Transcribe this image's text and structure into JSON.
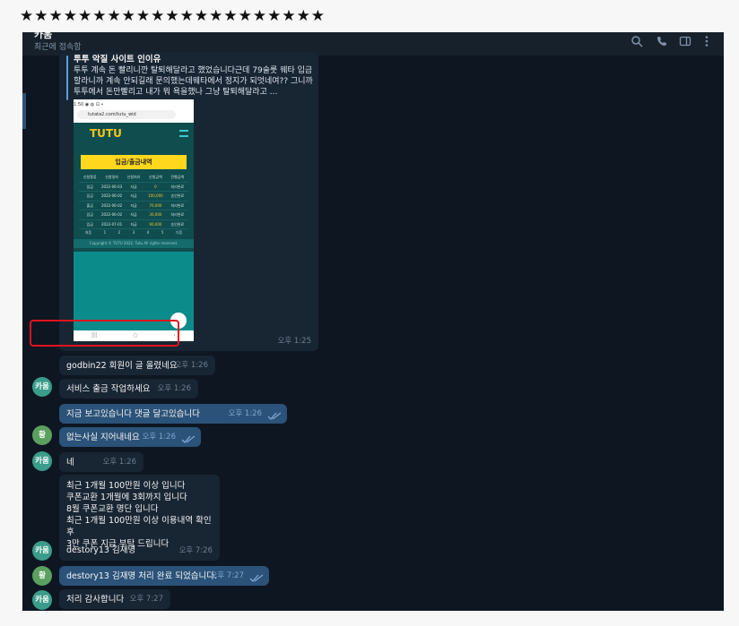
{
  "decor": {
    "stars": "★★★★★★★★★★★★★★★★★★★★★"
  },
  "header": {
    "title": "카움",
    "status": "최근에 접속함"
  },
  "reply_message": {
    "title": "투투 악질 사이트 인이유",
    "text": "투투 계속 돈 빨리니깐 탈퇴해달라고 했었습니다근데 79술룻 웨타 입금할라니까 계속 안되길래 문의했는데웨타에서 정지가 되엇네여?? 그니까 투투에서 돈만빨리고 내가 뭐 욕을했나 그냥 탈퇴해달라고 ...",
    "time": "오후 1:25",
    "screenshot": {
      "status": "1:50 ◉ ◍ ⊡ •",
      "url": "tutata2.com/tutu_wid",
      "logo": "TUTU",
      "yellow_button": "입금/출금내역",
      "table_header": [
        "신청종류",
        "신청일자",
        "신청처리",
        "신청금액",
        "진행금액"
      ],
      "rows": [
        [
          "입금",
          "2022-06-03",
          "지급",
          "0",
          "처리완료"
        ],
        [
          "입금",
          "2022-06-02",
          "지급",
          "100,000",
          "승인완료"
        ],
        [
          "출금",
          "2022-06-02",
          "지급",
          "70,000",
          "처리완료"
        ],
        [
          "입금",
          "2022-06-02",
          "지급",
          "30,000",
          "처리완료"
        ],
        [
          "입금",
          "2022-07-01",
          "지급",
          "90,000",
          "승인완료"
        ]
      ],
      "pager": [
        "처음",
        "1",
        "2",
        "3",
        "4",
        "5",
        "다음"
      ],
      "footer": "Copyright © TUTU 2022. Tutu All rights reserved.",
      "nav": [
        "|||",
        "○",
        "‹"
      ]
    }
  },
  "messages": [
    {
      "text": "godbin22 회원이 글 올렸네요",
      "time": "오후 1:26",
      "dir": "in"
    },
    {
      "text": "서비스 출금 작업하세요",
      "time": "오후 1:26",
      "dir": "in",
      "avatar": "카움"
    },
    {
      "text": "지금 보고있습니다 댓글 달고있습니다",
      "time": "오후 1:26",
      "dir": "out"
    },
    {
      "text": "없는사실 지어내네요",
      "time": "오후 1:26",
      "dir": "out",
      "avatar": "황"
    },
    {
      "text": "네",
      "time": "오후 1:26",
      "dir": "in",
      "avatar": "카움"
    },
    {
      "lines": [
        "최근 1개월 100만원 이상 입니다",
        "쿠폰교환 1개월에 3회까지 입니다",
        "8월 쿠폰교환 명단 입니다",
        "최근 1개월 100만원 이상 이용내역 확인후",
        "3만 쿠폰 지급 부탁 드립니다"
      ],
      "dir": "in"
    },
    {
      "text": "destory13 김재명",
      "time": "오후 7:26",
      "dir": "in",
      "avatar": "카움"
    },
    {
      "text": "destory13 김재명 처리 완료 되었습니다.",
      "time": "오후 7:27",
      "dir": "out",
      "avatar": "황"
    },
    {
      "text": "처리 감사합니다",
      "time": "오후 7:27",
      "dir": "in",
      "avatar": "카움"
    }
  ],
  "colors": {
    "bg": "#0e1621",
    "in_bubble": "#182533",
    "out_bubble": "#2b5278",
    "highlight": "#e1131e"
  }
}
